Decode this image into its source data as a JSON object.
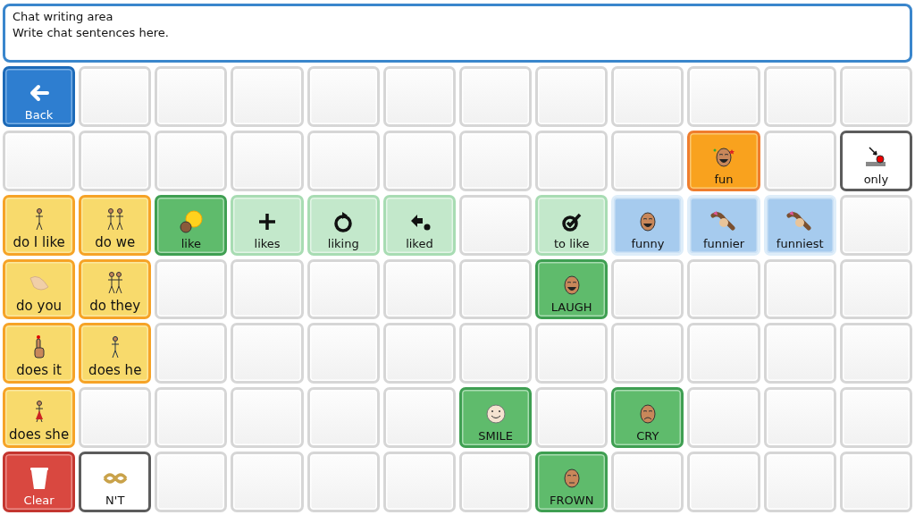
{
  "chat": {
    "title": "Chat writing area",
    "placeholder": "Write chat sentences here."
  },
  "rows": [
    {
      "cells": [
        {
          "kind": "back",
          "label": "Back"
        },
        {
          "kind": "empty"
        },
        {
          "kind": "empty"
        },
        {
          "kind": "empty"
        },
        {
          "kind": "empty"
        },
        {
          "kind": "empty"
        },
        {
          "kind": "empty"
        },
        {
          "kind": "empty"
        },
        {
          "kind": "empty"
        },
        {
          "kind": "empty"
        },
        {
          "kind": "empty"
        },
        {
          "kind": "empty"
        }
      ]
    },
    {
      "cells": [
        {
          "kind": "empty"
        },
        {
          "kind": "empty"
        },
        {
          "kind": "empty"
        },
        {
          "kind": "empty"
        },
        {
          "kind": "empty"
        },
        {
          "kind": "empty"
        },
        {
          "kind": "empty"
        },
        {
          "kind": "empty"
        },
        {
          "kind": "empty"
        },
        {
          "kind": "adjective",
          "label": "fun"
        },
        {
          "kind": "empty"
        },
        {
          "kind": "word",
          "label": "only"
        }
      ]
    },
    {
      "cells": [
        {
          "kind": "pronoun",
          "label": "do I like"
        },
        {
          "kind": "pronoun",
          "label": "do we"
        },
        {
          "kind": "verb",
          "label": "like"
        },
        {
          "kind": "verb-form",
          "label": "likes"
        },
        {
          "kind": "verb-form",
          "label": "liking"
        },
        {
          "kind": "verb-form",
          "label": "liked"
        },
        {
          "kind": "empty"
        },
        {
          "kind": "verb-form",
          "label": "to like"
        },
        {
          "kind": "adjective-form",
          "label": "funny"
        },
        {
          "kind": "adjective-form",
          "label": "funnier"
        },
        {
          "kind": "adjective-form",
          "label": "funniest"
        },
        {
          "kind": "empty"
        }
      ]
    },
    {
      "cells": [
        {
          "kind": "pronoun",
          "label": "do you"
        },
        {
          "kind": "pronoun",
          "label": "do they"
        },
        {
          "kind": "empty"
        },
        {
          "kind": "empty"
        },
        {
          "kind": "empty"
        },
        {
          "kind": "empty"
        },
        {
          "kind": "empty"
        },
        {
          "kind": "verb",
          "label": "LAUGH"
        },
        {
          "kind": "empty"
        },
        {
          "kind": "empty"
        },
        {
          "kind": "empty"
        },
        {
          "kind": "empty"
        }
      ]
    },
    {
      "cells": [
        {
          "kind": "pronoun",
          "label": "does it"
        },
        {
          "kind": "pronoun",
          "label": "does he"
        },
        {
          "kind": "empty"
        },
        {
          "kind": "empty"
        },
        {
          "kind": "empty"
        },
        {
          "kind": "empty"
        },
        {
          "kind": "empty"
        },
        {
          "kind": "empty"
        },
        {
          "kind": "empty"
        },
        {
          "kind": "empty"
        },
        {
          "kind": "empty"
        },
        {
          "kind": "empty"
        }
      ]
    },
    {
      "cells": [
        {
          "kind": "pronoun",
          "label": "does she"
        },
        {
          "kind": "empty"
        },
        {
          "kind": "empty"
        },
        {
          "kind": "empty"
        },
        {
          "kind": "empty"
        },
        {
          "kind": "empty"
        },
        {
          "kind": "verb",
          "label": "SMILE"
        },
        {
          "kind": "empty"
        },
        {
          "kind": "verb",
          "label": "CRY"
        },
        {
          "kind": "empty"
        },
        {
          "kind": "empty"
        },
        {
          "kind": "empty"
        }
      ]
    },
    {
      "cells": [
        {
          "kind": "clear",
          "label": "Clear"
        },
        {
          "kind": "word",
          "label": "N'T"
        },
        {
          "kind": "empty"
        },
        {
          "kind": "empty"
        },
        {
          "kind": "empty"
        },
        {
          "kind": "empty"
        },
        {
          "kind": "empty"
        },
        {
          "kind": "verb",
          "label": "FROWN"
        },
        {
          "kind": "empty"
        },
        {
          "kind": "empty"
        },
        {
          "kind": "empty"
        },
        {
          "kind": "empty"
        }
      ]
    }
  ]
}
